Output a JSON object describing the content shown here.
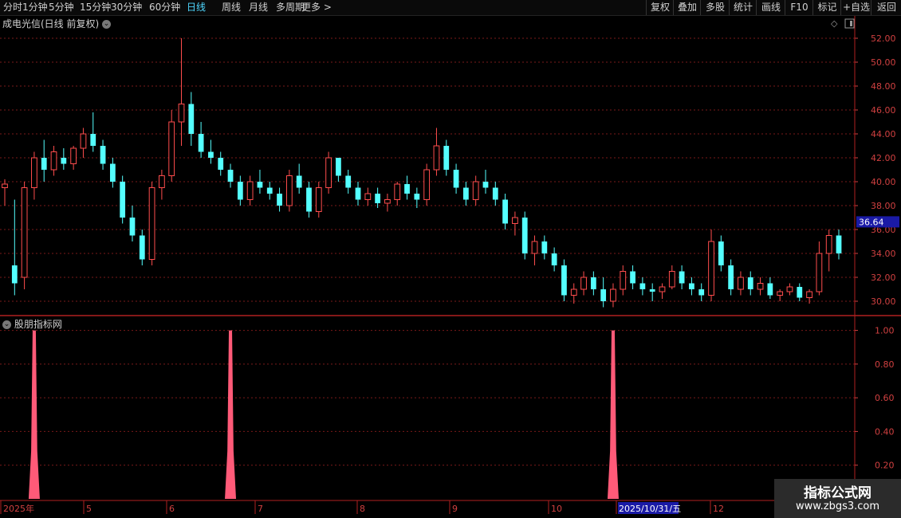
{
  "toolbar": {
    "periods": [
      "分时",
      "1分钟",
      "5分钟",
      "15分钟",
      "30分钟",
      "60分钟",
      "日线",
      "周线",
      "月线",
      "多周期",
      "更多 >"
    ],
    "active_index": 6,
    "right_buttons": [
      "复权",
      "叠加",
      "多股",
      "统计",
      "画线",
      "F10",
      "标记",
      "+自选",
      "返回"
    ]
  },
  "main_chart": {
    "title": "成电光信(日线 前复权)",
    "price_tag": "36.64"
  },
  "indicator": {
    "title": "股朋指标网"
  },
  "date_axis": {
    "labels": [
      "2025年",
      "5",
      "6",
      "7",
      "8",
      "9",
      "10",
      "2025/10/31/五",
      "12"
    ]
  },
  "watermark": {
    "title": "指标公式网",
    "url": "www.zbgs3.com"
  },
  "colors": {
    "up": "#ff4d4d",
    "down": "#54ffff",
    "indicator_bar": "#ff5a78",
    "grid": "#7a1a1a",
    "axis_text": "#d04040"
  },
  "chart_data": [
    {
      "type": "candlestick",
      "title": "成电光信(日线 前复权)",
      "y_ticks": [
        52.0,
        50.0,
        48.0,
        46.0,
        44.0,
        42.0,
        40.0,
        38.0,
        36.0,
        34.0,
        32.0,
        30.0
      ],
      "ylim": [
        29.2,
        52.8
      ],
      "last_price": 36.64,
      "x_labels": [
        "2025年",
        "5",
        "6",
        "7",
        "8",
        "9",
        "10",
        "2025/10/31/五",
        "12"
      ],
      "candles": [
        [
          39.5,
          40.2,
          38.0,
          39.8
        ],
        [
          33.0,
          38.5,
          30.5,
          31.5
        ],
        [
          32.0,
          40.0,
          31.0,
          39.5
        ],
        [
          39.5,
          42.5,
          38.5,
          42.0
        ],
        [
          42.0,
          43.5,
          40.0,
          41.0
        ],
        [
          41.0,
          43.0,
          40.5,
          42.5
        ],
        [
          42.0,
          42.8,
          41.0,
          41.5
        ],
        [
          41.5,
          43.0,
          41.0,
          42.8
        ],
        [
          42.8,
          44.5,
          42.0,
          44.0
        ],
        [
          44.0,
          45.8,
          42.5,
          43.0
        ],
        [
          43.0,
          43.5,
          41.0,
          41.5
        ],
        [
          41.5,
          42.0,
          39.5,
          40.0
        ],
        [
          40.0,
          40.5,
          36.5,
          37.0
        ],
        [
          37.0,
          38.0,
          35.0,
          35.5
        ],
        [
          35.5,
          36.0,
          33.0,
          33.5
        ],
        [
          33.5,
          40.0,
          33.0,
          39.5
        ],
        [
          39.5,
          41.0,
          38.5,
          40.5
        ],
        [
          40.5,
          46.0,
          40.0,
          45.0
        ],
        [
          45.0,
          52.0,
          43.0,
          46.5
        ],
        [
          46.5,
          47.5,
          43.0,
          44.0
        ],
        [
          44.0,
          45.0,
          42.0,
          42.5
        ],
        [
          42.5,
          43.5,
          41.5,
          42.0
        ],
        [
          42.0,
          42.5,
          40.5,
          41.0
        ],
        [
          41.0,
          41.5,
          39.5,
          40.0
        ],
        [
          40.0,
          40.5,
          38.0,
          38.5
        ],
        [
          38.5,
          40.5,
          38.0,
          40.0
        ],
        [
          40.0,
          41.0,
          39.0,
          39.5
        ],
        [
          39.5,
          40.0,
          38.5,
          39.0
        ],
        [
          39.0,
          39.5,
          37.5,
          38.0
        ],
        [
          38.0,
          41.0,
          37.5,
          40.5
        ],
        [
          40.5,
          41.5,
          39.0,
          39.5
        ],
        [
          39.5,
          40.0,
          37.0,
          37.5
        ],
        [
          37.5,
          40.0,
          37.0,
          39.5
        ],
        [
          39.5,
          42.5,
          39.0,
          42.0
        ],
        [
          42.0,
          42.0,
          40.0,
          40.5
        ],
        [
          40.5,
          41.0,
          39.0,
          39.5
        ],
        [
          39.5,
          40.0,
          38.0,
          38.5
        ],
        [
          38.5,
          39.5,
          38.0,
          39.0
        ],
        [
          39.0,
          39.5,
          37.8,
          38.2
        ],
        [
          38.2,
          39.0,
          37.5,
          38.5
        ],
        [
          38.5,
          40.0,
          38.0,
          39.8
        ],
        [
          39.8,
          40.5,
          38.5,
          39.0
        ],
        [
          39.0,
          39.5,
          37.8,
          38.5
        ],
        [
          38.5,
          41.5,
          38.0,
          41.0
        ],
        [
          41.0,
          44.5,
          40.5,
          43.0
        ],
        [
          43.0,
          43.5,
          40.5,
          41.0
        ],
        [
          41.0,
          41.5,
          39.0,
          39.5
        ],
        [
          39.5,
          40.0,
          38.0,
          38.5
        ],
        [
          38.5,
          40.5,
          38.0,
          40.0
        ],
        [
          40.0,
          41.0,
          39.0,
          39.5
        ],
        [
          39.5,
          40.0,
          38.0,
          38.5
        ],
        [
          38.5,
          39.0,
          36.0,
          36.5
        ],
        [
          36.5,
          37.5,
          35.5,
          37.0
        ],
        [
          37.0,
          37.5,
          33.5,
          34.0
        ],
        [
          34.0,
          35.5,
          33.0,
          35.0
        ],
        [
          35.0,
          35.5,
          33.5,
          34.0
        ],
        [
          34.0,
          34.5,
          32.5,
          33.0
        ],
        [
          33.0,
          33.5,
          30.0,
          30.5
        ],
        [
          30.5,
          31.5,
          29.8,
          31.0
        ],
        [
          31.0,
          32.5,
          30.5,
          32.0
        ],
        [
          32.0,
          32.5,
          30.5,
          31.0
        ],
        [
          31.0,
          32.0,
          29.5,
          30.0
        ],
        [
          30.0,
          31.5,
          29.5,
          31.0
        ],
        [
          31.0,
          33.0,
          30.5,
          32.5
        ],
        [
          32.5,
          33.0,
          31.0,
          31.5
        ],
        [
          31.5,
          32.0,
          30.5,
          31.0
        ],
        [
          31.0,
          31.5,
          30.0,
          30.8
        ],
        [
          30.8,
          31.5,
          30.2,
          31.2
        ],
        [
          31.2,
          33.0,
          31.0,
          32.5
        ],
        [
          32.5,
          33.0,
          31.0,
          31.5
        ],
        [
          31.5,
          32.0,
          30.5,
          31.0
        ],
        [
          31.0,
          31.5,
          30.0,
          30.5
        ],
        [
          30.5,
          36.0,
          30.0,
          35.0
        ],
        [
          35.0,
          35.5,
          32.5,
          33.0
        ],
        [
          33.0,
          33.5,
          30.5,
          31.0
        ],
        [
          31.0,
          32.5,
          30.5,
          32.0
        ],
        [
          32.0,
          32.5,
          30.5,
          31.0
        ],
        [
          31.0,
          32.0,
          30.5,
          31.5
        ],
        [
          31.5,
          32.0,
          30.2,
          30.5
        ],
        [
          30.5,
          31.0,
          30.0,
          30.8
        ],
        [
          30.8,
          31.5,
          30.5,
          31.2
        ],
        [
          31.2,
          31.5,
          30.0,
          30.3
        ],
        [
          30.3,
          31.0,
          29.8,
          30.8
        ],
        [
          30.8,
          35.0,
          30.5,
          34.0
        ],
        [
          34.0,
          36.0,
          32.5,
          35.5
        ],
        [
          35.5,
          36.0,
          33.5,
          34.0
        ]
      ]
    },
    {
      "type": "area",
      "title": "股朋指标网",
      "y_ticks": [
        1.0,
        0.8,
        0.6,
        0.4,
        0.2
      ],
      "ylim": [
        0,
        1.05
      ],
      "spikes": [
        {
          "x_index": 3,
          "value": 1.0
        },
        {
          "x_index": 23,
          "value": 1.0
        },
        {
          "x_index": 62,
          "value": 1.0
        }
      ]
    }
  ]
}
